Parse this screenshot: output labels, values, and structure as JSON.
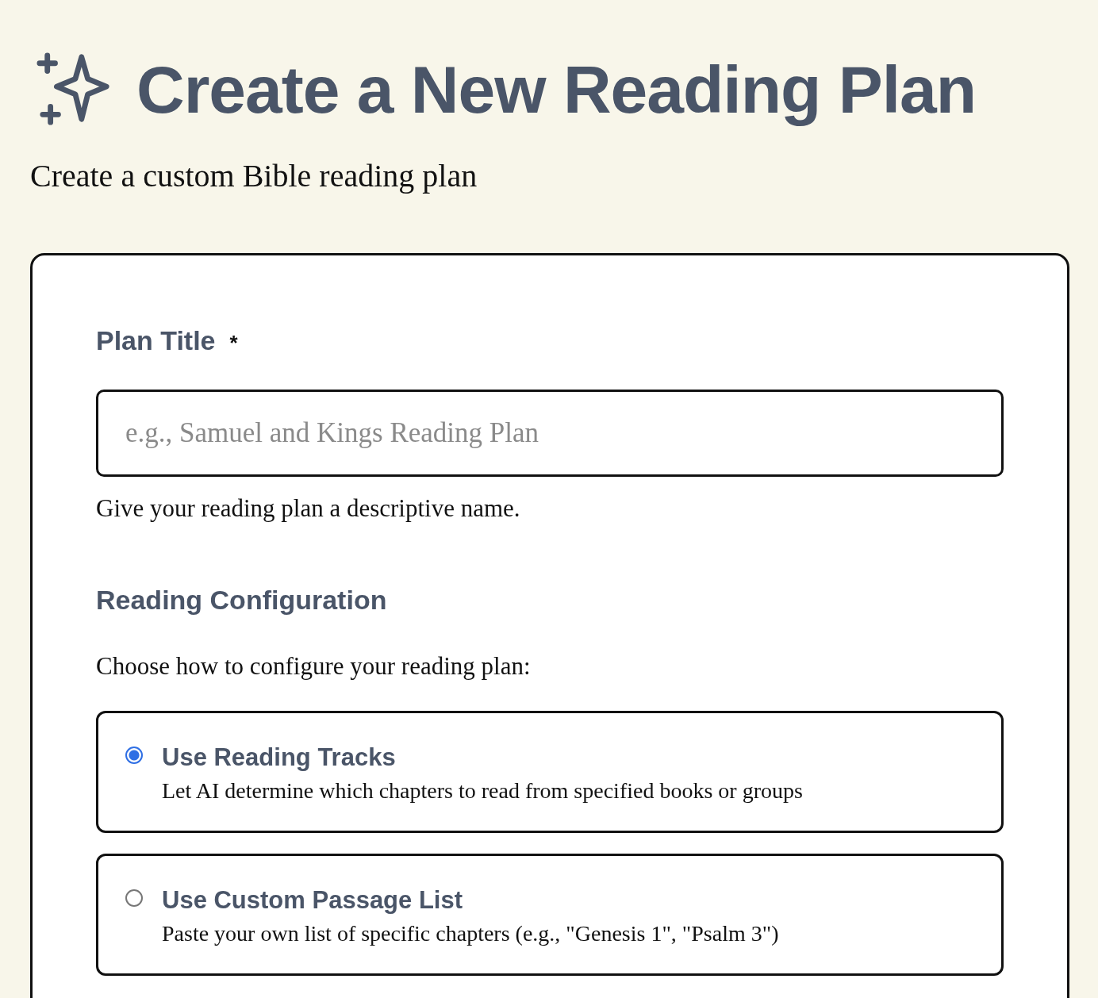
{
  "header": {
    "title": "Create a New Reading Plan",
    "subtitle": "Create a custom Bible reading plan"
  },
  "form": {
    "title_field": {
      "label": "Plan Title",
      "required_mark": "*",
      "placeholder": "e.g., Samuel and Kings Reading Plan",
      "help": "Give your reading plan a descriptive name."
    },
    "configuration": {
      "heading": "Reading Configuration",
      "prompt": "Choose how to configure your reading plan:",
      "options": [
        {
          "label": "Use Reading Tracks",
          "description": "Let AI determine which chapters to read from specified books or groups",
          "selected": true
        },
        {
          "label": "Use Custom Passage List",
          "description": "Paste your own list of specific chapters (e.g., \"Genesis 1\", \"Psalm 3\")",
          "selected": false
        }
      ]
    }
  }
}
